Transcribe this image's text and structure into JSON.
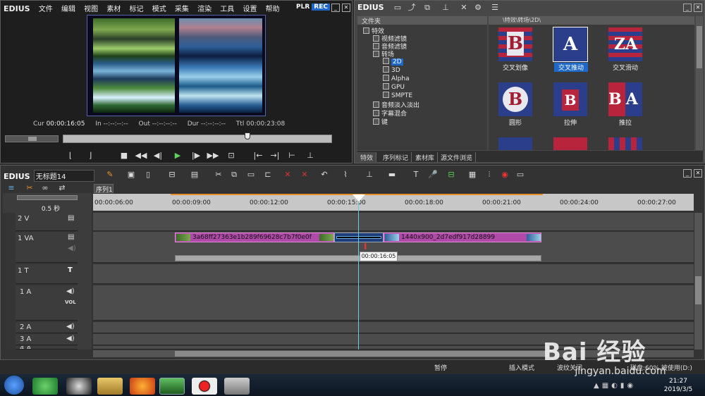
{
  "player": {
    "brand": "EDIUS",
    "menu": [
      "文件",
      "编辑",
      "视图",
      "素材",
      "标记",
      "模式",
      "采集",
      "渲染",
      "工具",
      "设置",
      "帮助"
    ],
    "plr": "PLR",
    "rec": "REC",
    "cur_label": "Cur",
    "cur": "00:00:16:05",
    "in_label": "In",
    "in": "--:--:--:--",
    "out_label": "Out",
    "out": "--:--:--:--",
    "dur_label": "Dur",
    "dur": "--:--:--:--",
    "ttl_label": "Ttl",
    "ttl": "00:00:23:08"
  },
  "effects": {
    "brand": "EDIUS",
    "folder_header": "文件夹",
    "path": "\\特效\\转场\\2D\\",
    "tree": [
      {
        "label": "特效",
        "depth": 0
      },
      {
        "label": "视频滤镜",
        "depth": 1
      },
      {
        "label": "音频滤镜",
        "depth": 1
      },
      {
        "label": "转场",
        "depth": 1
      },
      {
        "label": "2D",
        "depth": 2,
        "selected": true
      },
      {
        "label": "3D",
        "depth": 2
      },
      {
        "label": "Alpha",
        "depth": 2
      },
      {
        "label": "GPU",
        "depth": 2
      },
      {
        "label": "SMPTE",
        "depth": 2
      },
      {
        "label": "音频淡入淡出",
        "depth": 1
      },
      {
        "label": "字幕混合",
        "depth": 1
      },
      {
        "label": "键",
        "depth": 1
      }
    ],
    "items": [
      {
        "label": "交叉划像",
        "selected": false
      },
      {
        "label": "交叉推动",
        "selected": true
      },
      {
        "label": "交叉滑动",
        "selected": false
      },
      {
        "label": "圆形",
        "selected": false
      },
      {
        "label": "拉伸",
        "selected": false
      },
      {
        "label": "推拉",
        "selected": false
      }
    ],
    "tabs": [
      "特效",
      "序列标记",
      "素材库",
      "源文件浏览"
    ]
  },
  "timeline": {
    "brand": "EDIUS",
    "project_name": "无标题14",
    "sequence_tab": "序列1",
    "zoom": "0.5 秒",
    "ruler": [
      "00:00:06:00",
      "00:00:09:00",
      "00:00:12:00",
      "00:00:15:00",
      "00:00:18:00",
      "00:00:21:00",
      "00:00:24:00",
      "00:00:27:00"
    ],
    "tracks": [
      {
        "name": "2 V"
      },
      {
        "name": "1 VA"
      },
      {
        "name": "1 T",
        "icon": "T"
      },
      {
        "name": "1 A",
        "vol": "VOL"
      },
      {
        "name": "2 A"
      },
      {
        "name": "3 A"
      },
      {
        "name": "4 A"
      }
    ],
    "clip1": "3a68ff27363e1b289f69628c7b7f0e0f",
    "clip2": "1440x900_2d7edf917d28899",
    "tooltip": "00:00:16:05"
  },
  "statusbar": {
    "state": "暂停",
    "mode": "插入模式",
    "ripple": "波纹关闭",
    "disk": "磁盘:60% 被使用(D:)"
  },
  "taskbar": {
    "time": "21:27",
    "date": "2019/3/5"
  },
  "watermark": {
    "brand": "Bai 经验",
    "url": "jingyan.baidu.com"
  }
}
